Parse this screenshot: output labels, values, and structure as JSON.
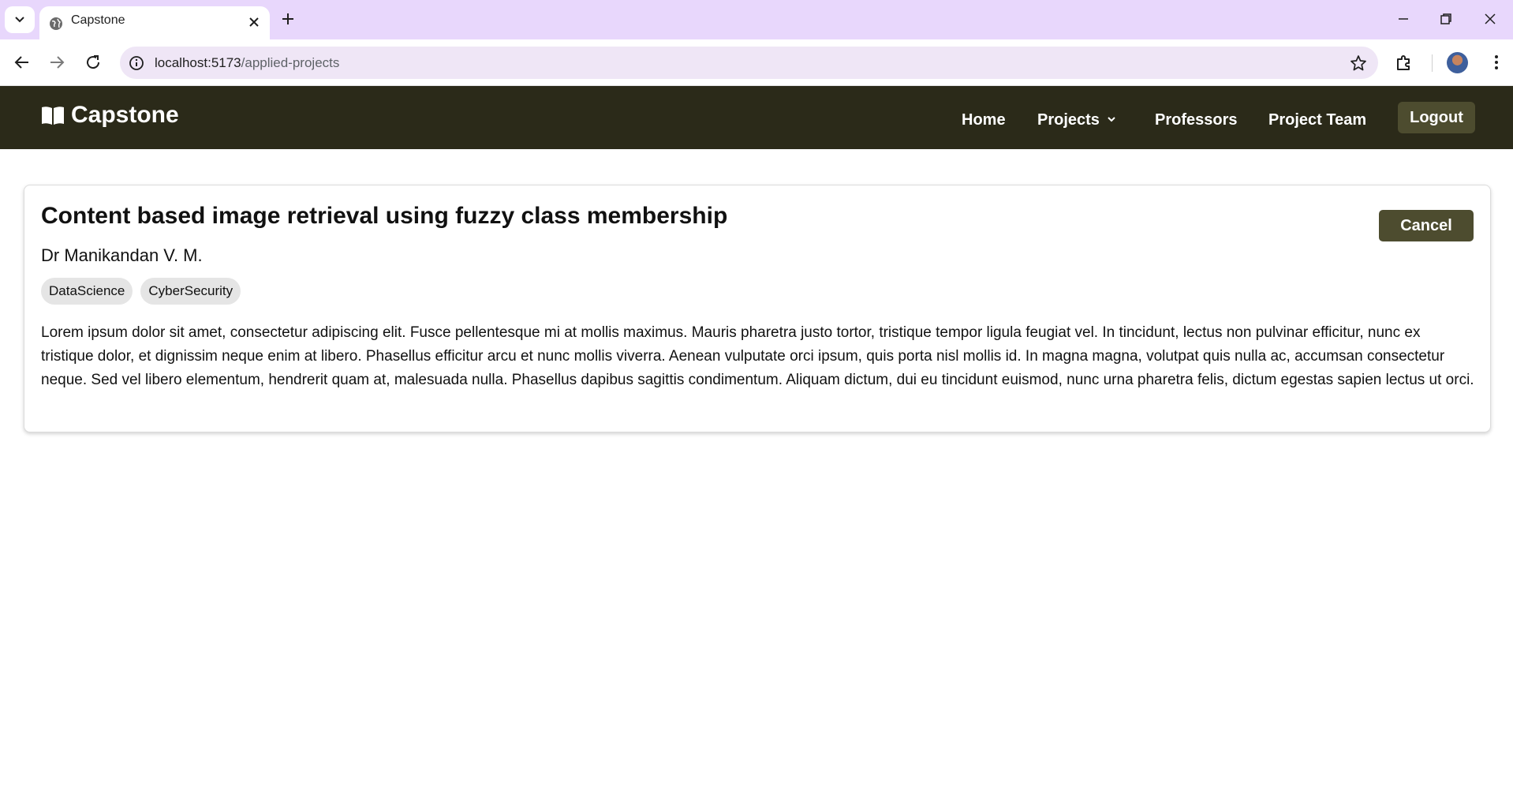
{
  "browser": {
    "tab": {
      "title": "Capstone"
    },
    "omnibox": {
      "host": "localhost:5173",
      "path": "/applied-projects"
    },
    "icons": [
      "tab-search-icon",
      "globe-icon",
      "close-icon",
      "plus-icon",
      "minimize-icon",
      "restore-icon",
      "window-close-icon",
      "back-arrow-icon",
      "forward-arrow-icon",
      "reload-icon",
      "site-info-icon",
      "star-icon",
      "extensions-icon",
      "avatar",
      "kebab-menu-icon"
    ]
  },
  "navbar": {
    "brand": "Capstone",
    "brand_icon": "open-book-icon",
    "links": {
      "home": "Home",
      "projects": "Projects",
      "professors": "Professors",
      "project_team": "Project Team"
    },
    "logout": "Logout",
    "colors": {
      "background": "#2b2a19",
      "button": "#4d4c2f"
    }
  },
  "project": {
    "title": "Content based image retrieval using fuzzy class membership",
    "professor": "Dr Manikandan V. M.",
    "tags": [
      "DataScience",
      "CyberSecurity"
    ],
    "description": "Lorem ipsum dolor sit amet, consectetur adipiscing elit. Fusce pellentesque mi at mollis maximus. Mauris pharetra justo tortor, tristique tempor ligula feugiat vel. In tincidunt, lectus non pulvinar efficitur, nunc ex tristique dolor, et dignissim neque enim at libero. Phasellus efficitur arcu et nunc mollis viverra. Aenean vulputate orci ipsum, quis porta nisl mollis id. In magna magna, volutpat quis nulla ac, accumsan consectetur neque. Sed vel libero elementum, hendrerit quam at, malesuada nulla. Phasellus dapibus sagittis condimentum. Aliquam dictum, dui eu tincidunt euismod, nunc urna pharetra felis, dictum egestas sapien lectus ut orci.",
    "cancel": "Cancel"
  }
}
